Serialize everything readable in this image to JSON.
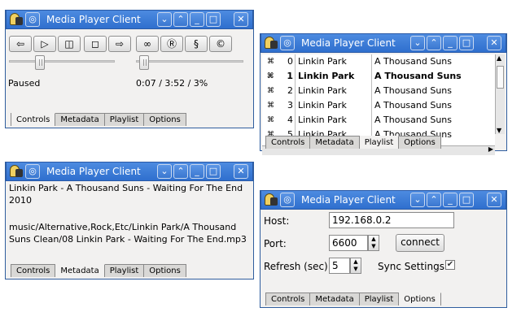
{
  "app_title": "Media Player Client",
  "tabs": [
    "Controls",
    "Metadata",
    "Playlist",
    "Options"
  ],
  "controls": {
    "buttons": [
      {
        "name": "prev-button",
        "glyph": "⇦"
      },
      {
        "name": "play-button",
        "glyph": "▷"
      },
      {
        "name": "pause-button",
        "glyph": "◫"
      },
      {
        "name": "stop-button",
        "glyph": "◻"
      },
      {
        "name": "next-button",
        "glyph": "⇨"
      },
      {
        "name": "repeat-button",
        "glyph": "∞"
      },
      {
        "name": "random-button",
        "glyph": "Ⓡ"
      },
      {
        "name": "single-button",
        "glyph": "§"
      },
      {
        "name": "consume-button",
        "glyph": "©"
      }
    ],
    "status": "Paused",
    "time": "0:07 / 3:52 / 3%",
    "volume_level": 0.27,
    "seek_level": 0.03
  },
  "playlist": {
    "rows": [
      {
        "num": "0",
        "artist": "Linkin Park",
        "album": "A Thousand Suns",
        "bold": false
      },
      {
        "num": "1",
        "artist": "Linkin Park",
        "album": "A Thousand Suns",
        "bold": true
      },
      {
        "num": "2",
        "artist": "Linkin Park",
        "album": "A Thousand Suns",
        "bold": false
      },
      {
        "num": "3",
        "artist": "Linkin Park",
        "album": "A Thousand Suns",
        "bold": false
      },
      {
        "num": "4",
        "artist": "Linkin Park",
        "album": "A Thousand Suns",
        "bold": false
      },
      {
        "num": "5",
        "artist": "Linkin Park",
        "album": "A Thousand Suns",
        "bold": false
      }
    ]
  },
  "metadata": {
    "title_line1": "Linkin Park - A Thousand Suns - Waiting For The End",
    "title_line2": "2010",
    "path_line1": "music/Alternative,Rock,Etc/Linkin Park/A Thousand",
    "path_line2": "Suns Clean/08 Linkin Park - Waiting For The End.mp3"
  },
  "options": {
    "host_label": "Host:",
    "host_value": "192.168.0.2",
    "port_label": "Port:",
    "port_value": "6600",
    "connect_label": "connect",
    "refresh_label": "Refresh (sec):",
    "refresh_value": "5",
    "sync_label": "Sync Settings:",
    "sync_checked": true
  }
}
